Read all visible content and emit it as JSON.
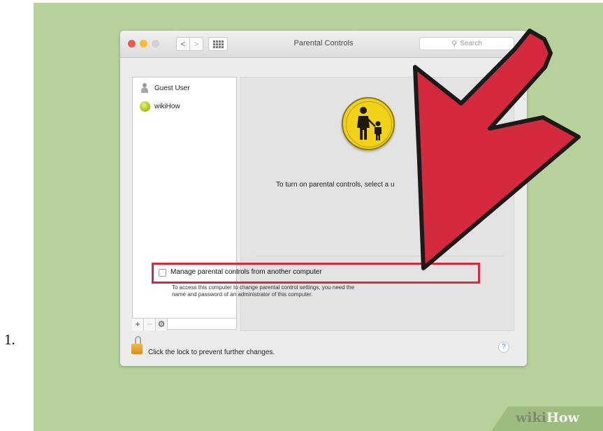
{
  "step_number": "1.",
  "window": {
    "title": "Parental Controls",
    "search_placeholder": "Search",
    "nav": {
      "back_glyph": "<",
      "forward_glyph": ">"
    }
  },
  "sidebar": {
    "users": [
      {
        "name": "Guest User",
        "icon": "guest-user-icon"
      },
      {
        "name": "wikiHow",
        "icon": "tennis-ball-avatar"
      }
    ],
    "buttons": {
      "add": "+",
      "remove": "−",
      "action": "⚙"
    }
  },
  "main": {
    "icon": "parental-controls-icon",
    "message": "To turn on parental controls, select a u",
    "checkbox_label": "Manage parental controls from another computer",
    "checkbox_checked": false,
    "help_text": "To access this computer to change parental control settings, you need the name and password of an administrator of this computer."
  },
  "footer": {
    "lock_text": "Click the lock to prevent further changes.",
    "help_glyph": "?"
  },
  "annotation": {
    "color": "#d52a3e",
    "highlight": "checkbox-row"
  },
  "watermark": {
    "part1": "wiki",
    "part2": "How"
  }
}
